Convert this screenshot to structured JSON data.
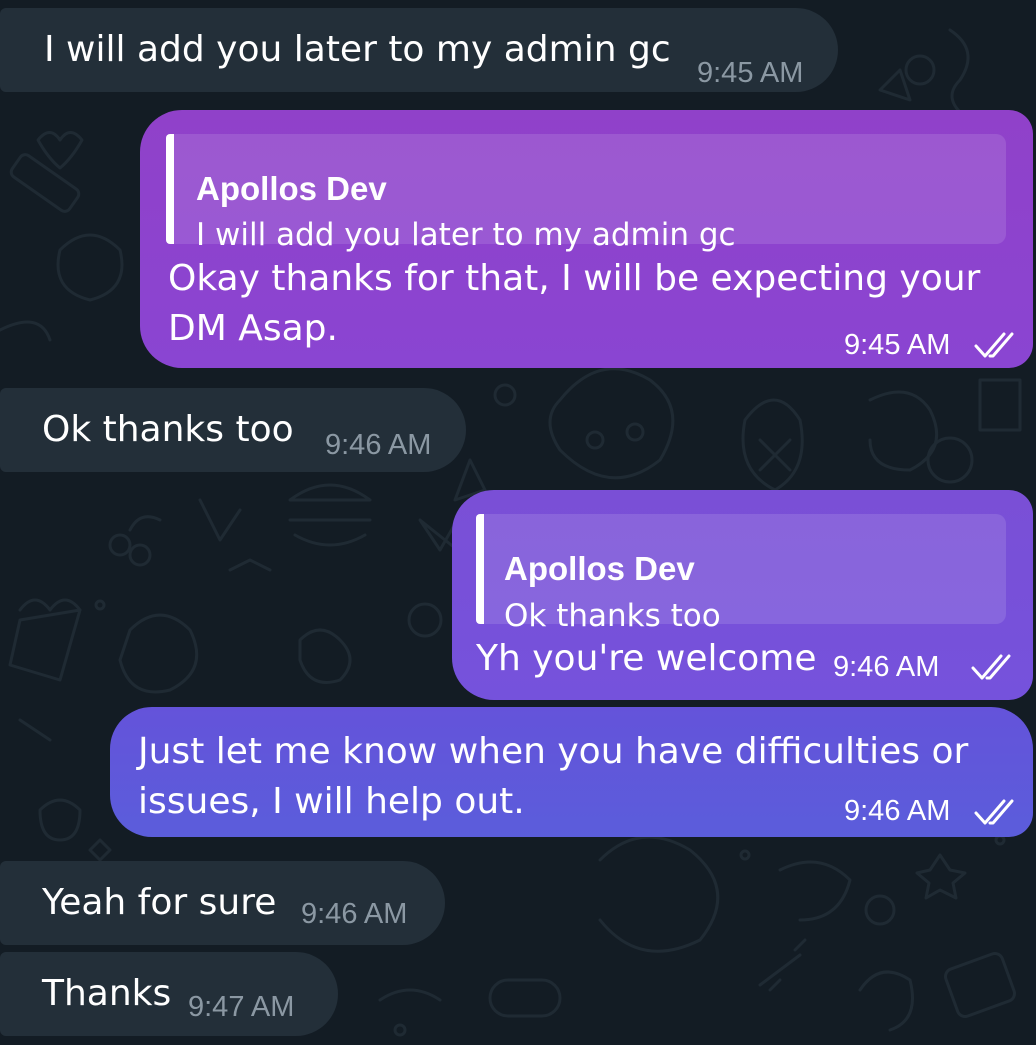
{
  "colors": {
    "background": "#131c24",
    "incoming_bubble": "#232f39",
    "outgoing_bubble_purple": "#8e44cc",
    "outgoing_bubble_blue": "#5b5ddb",
    "timestamp_incoming": "#8b98a3"
  },
  "messages": [
    {
      "direction": "incoming",
      "text": "I will add you later to my admin gc",
      "time": "9:45 AM"
    },
    {
      "direction": "outgoing",
      "reply_to": {
        "sender": "Apollos Dev",
        "text": "I will add you later to my admin gc"
      },
      "text_lines": [
        "Okay thanks for that, I will be expecting your",
        "DM Asap."
      ],
      "time": "9:45 AM",
      "status_icon": "double-check-icon"
    },
    {
      "direction": "incoming",
      "text": "Ok thanks too",
      "time": "9:46 AM"
    },
    {
      "direction": "outgoing",
      "reply_to": {
        "sender": "Apollos Dev",
        "text": "Ok thanks too"
      },
      "text": "Yh you're welcome",
      "time": "9:46 AM",
      "status_icon": "double-check-icon"
    },
    {
      "direction": "outgoing",
      "text_lines": [
        "Just let me know when you have difficulties or",
        "issues, I will help out."
      ],
      "time": "9:46 AM",
      "status_icon": "double-check-icon"
    },
    {
      "direction": "incoming",
      "text": "Yeah for sure",
      "time": "9:46 AM"
    },
    {
      "direction": "incoming",
      "text": "Thanks",
      "time": "9:47 AM"
    }
  ]
}
